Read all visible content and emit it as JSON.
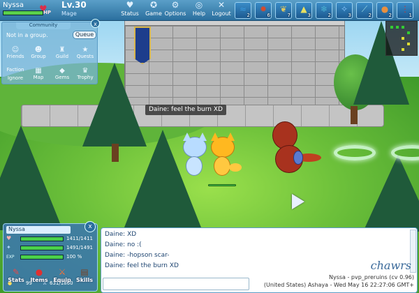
{
  "player": {
    "name": "Nyssa",
    "level": "Lv.30",
    "class": "Mage",
    "hp_label": "HP",
    "hp_fraction": 1.0
  },
  "menu": [
    {
      "name": "status",
      "label": "Status",
      "icon": "heart-icon"
    },
    {
      "name": "game",
      "label": "Game",
      "icon": "gamepad-icon"
    },
    {
      "name": "options",
      "label": "Options",
      "icon": "gear-icon"
    },
    {
      "name": "help",
      "label": "Help",
      "icon": "lifebuoy-icon"
    },
    {
      "name": "logout",
      "label": "Logout",
      "icon": "close-icon"
    }
  ],
  "skills": [
    {
      "count": "2",
      "icon": "wave-skill-icon",
      "color": "#3a9be0"
    },
    {
      "count": "6",
      "icon": "fire-skill-icon",
      "color": "#d84a2a"
    },
    {
      "count": "7",
      "icon": "wing-skill-icon",
      "color": "#e0c860"
    },
    {
      "count": "3",
      "icon": "flame-skill-icon",
      "color": "#e8e060"
    },
    {
      "count": "2",
      "icon": "ice-skill-icon",
      "color": "#4ab0d0"
    },
    {
      "count": "3",
      "icon": "sparkle-skill-icon",
      "color": "#8ac8ff"
    },
    {
      "count": "2",
      "icon": "blade-skill-icon",
      "color": "#9ad8e0"
    },
    {
      "count": "2",
      "icon": "drop-skill-icon",
      "color": "#e89040"
    },
    {
      "count": "1",
      "icon": "claw-skill-icon",
      "color": "#c03838"
    }
  ],
  "community": {
    "title": "Community",
    "group_status": "Not in a group.",
    "queue_label": "Queue",
    "close_label": "x",
    "items": [
      {
        "name": "friends",
        "label": "Friends",
        "icon": "friends-icon"
      },
      {
        "name": "group",
        "label": "Group",
        "icon": "group-icon"
      },
      {
        "name": "guild",
        "label": "Guild",
        "icon": "guild-icon"
      },
      {
        "name": "quests",
        "label": "Quests",
        "icon": "star-icon"
      },
      {
        "name": "faction",
        "label": "Faction",
        "icon": ""
      },
      {
        "name": "ignore",
        "label": "Ignore",
        "icon": ""
      },
      {
        "name": "map",
        "label": "Map",
        "icon": "map-icon"
      },
      {
        "name": "gems",
        "label": "Gems",
        "icon": "gem-icon"
      },
      {
        "name": "trophy",
        "label": "Trophy",
        "icon": "trophy-icon"
      }
    ]
  },
  "bubble": "Daine: feel the burn XD",
  "status_panel": {
    "name": "Nyssa",
    "close_label": "x",
    "rows": [
      {
        "name": "hp",
        "value": "1411/1411",
        "fraction": 1.0,
        "color": "#4ad04a",
        "icon": "heart-icon"
      },
      {
        "name": "mp",
        "value": "1491/1491",
        "fraction": 1.0,
        "color": "#4ad04a",
        "icon": "mana-icon"
      },
      {
        "name": "exp",
        "label": "EXP",
        "value": "100 %",
        "fraction": 1.0,
        "color": "#4ad04a",
        "icon": "exp-icon"
      }
    ],
    "gold": "99",
    "capacity": "631/1860",
    "buttons": [
      {
        "name": "stats",
        "label": "Stats",
        "icon": "pencil-icon"
      },
      {
        "name": "items",
        "label": "Items",
        "icon": "apple-icon"
      },
      {
        "name": "equip",
        "label": "Equip",
        "icon": "sword-icon"
      },
      {
        "name": "skills",
        "label": "Skills",
        "icon": "book-icon"
      }
    ]
  },
  "chat": {
    "lines": [
      "Daine: XD",
      "Daine: no :(",
      "Daine: -hopson scar-",
      "Daine: feel the burn XD"
    ],
    "input_value": "",
    "brand": "chawrs",
    "server": "Nyssa - pvp_preruins (cv 0.96)",
    "datetime": "(United States) Ashaya - Wed May 16 22:27:06 GMT+"
  },
  "colors": {
    "accent": "#2b6f9e",
    "hp_green": "#4ad04a"
  }
}
